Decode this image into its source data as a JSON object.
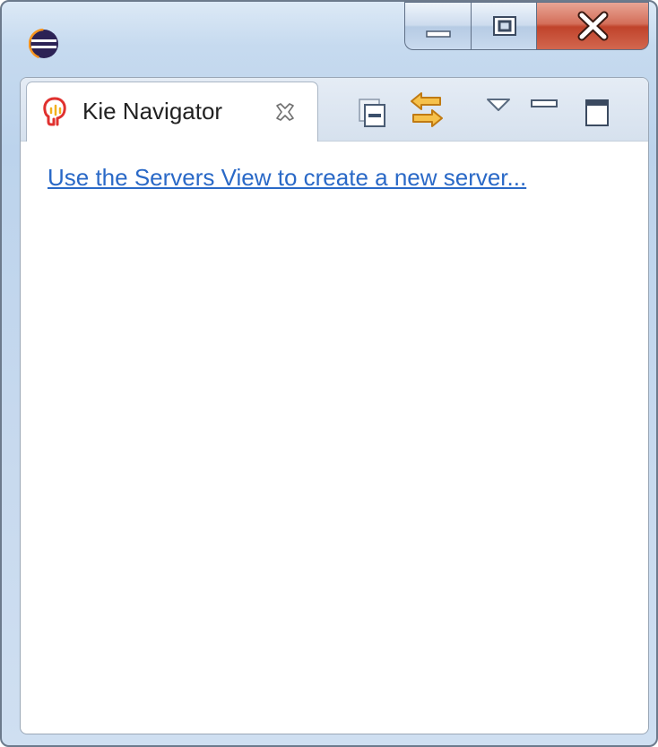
{
  "view": {
    "tab_label": "Kie Navigator",
    "empty_message_link": "Use the Servers View to create a new server..."
  },
  "icons": {
    "app": "eclipse-icon",
    "tab": "kie-icon",
    "tab_close": "close-icon",
    "toolbar": [
      "collapse-all-icon",
      "link-with-editor-icon",
      "view-menu-icon",
      "minimize-icon",
      "maximize-icon"
    ],
    "window_controls": [
      "window-minimize-icon",
      "window-maximize-icon",
      "window-close-icon"
    ]
  },
  "colors": {
    "link": "#2a69c7",
    "close_button": "#c0432b",
    "accent_orange": "#e8a23a"
  }
}
